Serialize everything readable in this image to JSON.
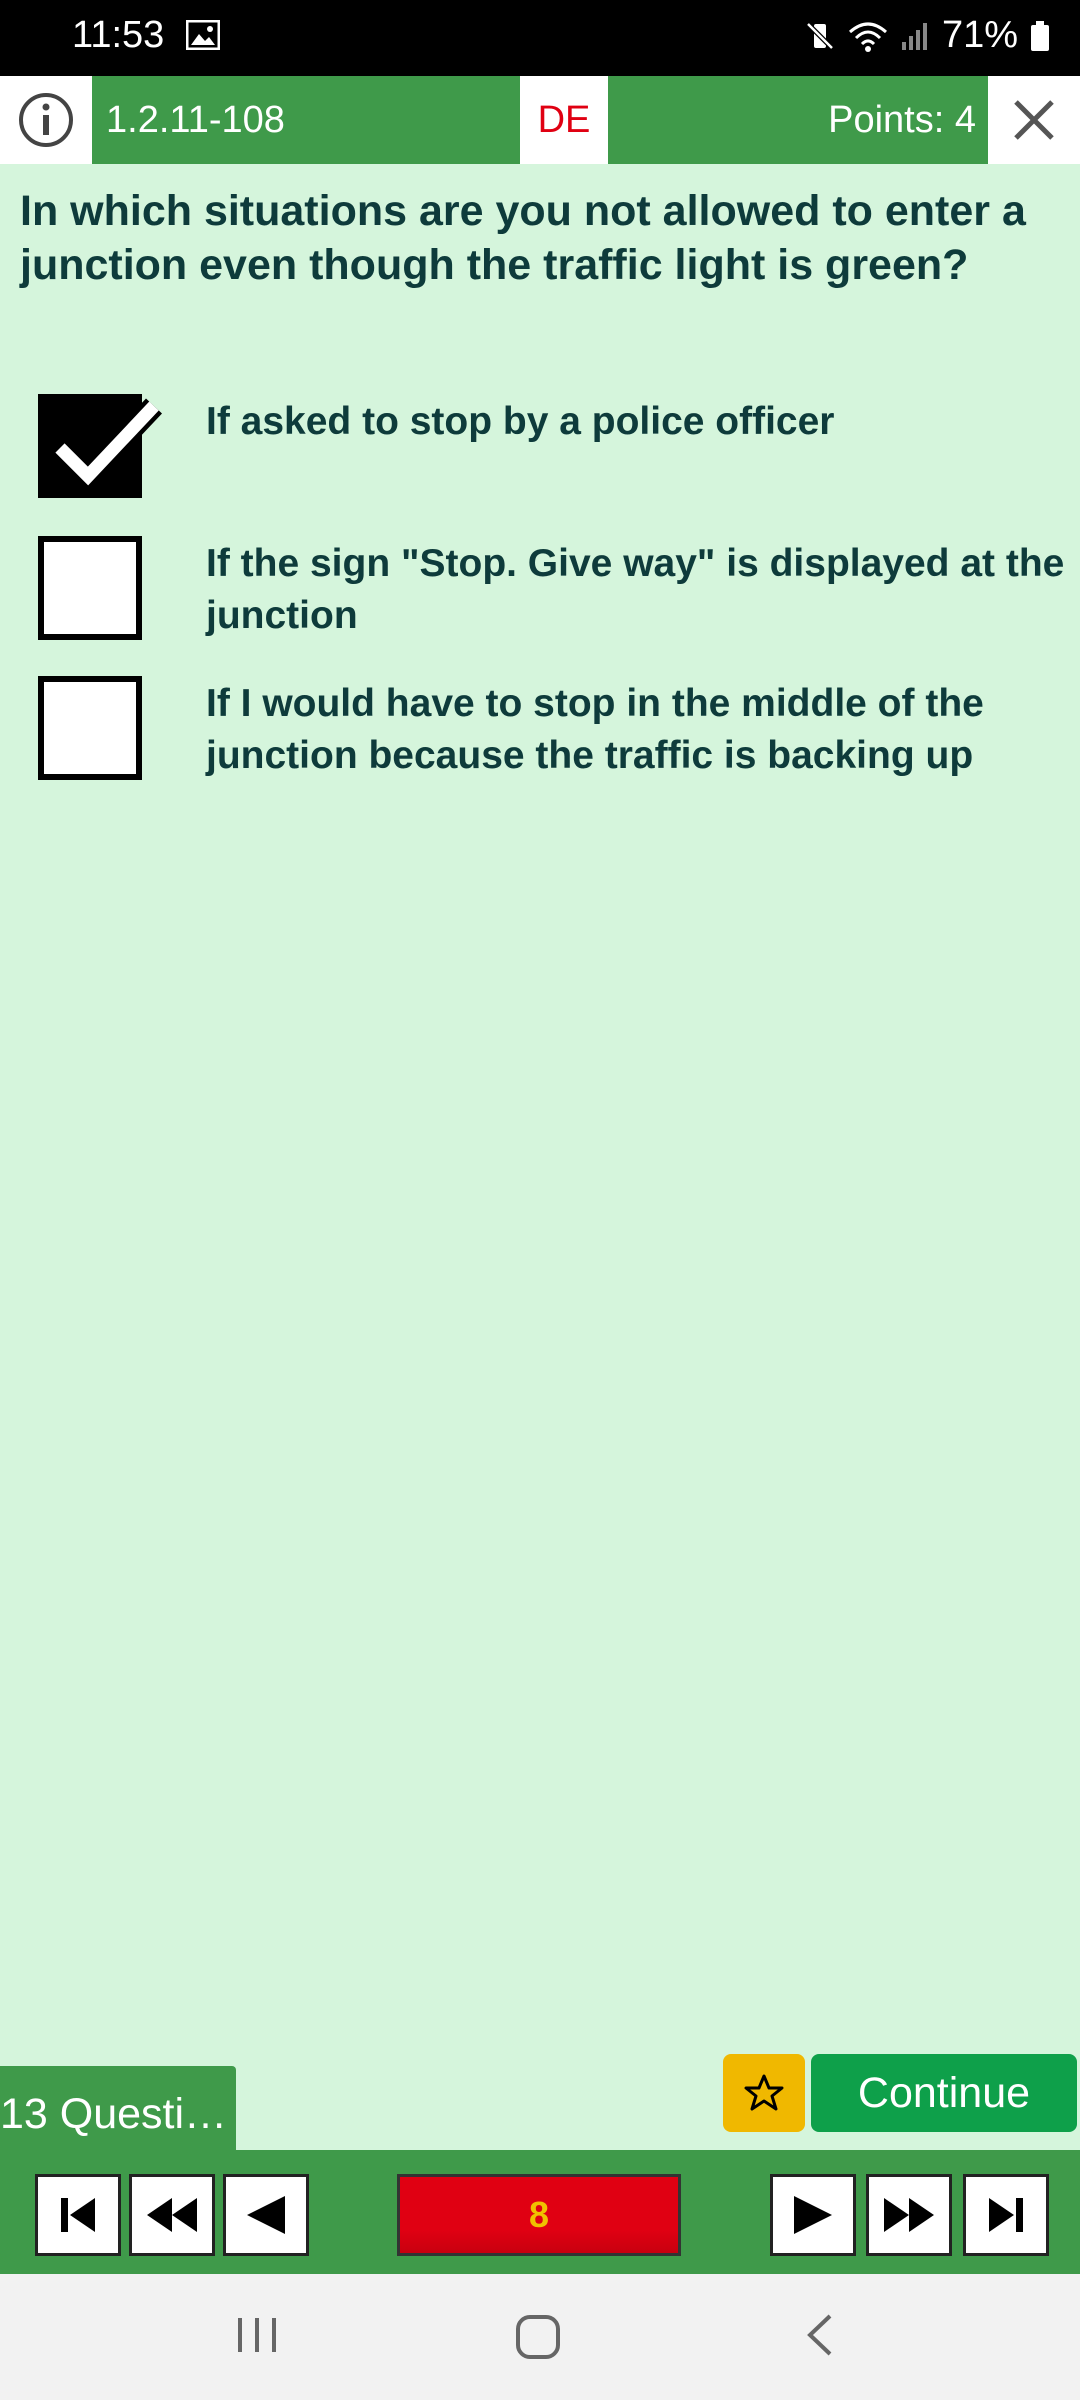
{
  "status_bar": {
    "time": "11:53",
    "battery": "71%"
  },
  "header": {
    "question_id": "1.2.11-108",
    "language": "DE",
    "points": "Points: 4"
  },
  "question": {
    "text": "In which situations are you not allowed to enter a junction even though the traffic light is green?"
  },
  "answers": [
    {
      "text": "If asked to stop by a police officer",
      "checked": true
    },
    {
      "text": "If the sign \"Stop. Give way\" is displayed at the junction",
      "checked": false
    },
    {
      "text": "If I would have to stop in the middle of the junction because the traffic is backing up",
      "checked": false
    }
  ],
  "footer": {
    "questions_tab": "13 Questi…",
    "continue_label": "Continue",
    "counter": "8"
  },
  "colors": {
    "header_green": "#3f9a4a",
    "background": "#d5f5dc",
    "continue_green": "#0ea04a",
    "star_yellow": "#f0b800",
    "counter_red": "#e00012",
    "text_dark": "#0e3b3b"
  },
  "icons": {
    "info": "info-icon",
    "close": "close-icon",
    "star": "star-icon",
    "first": "skip-first-icon",
    "back_fast": "rewind-icon",
    "back": "prev-icon",
    "forward": "next-icon",
    "forward_fast": "fast-forward-icon",
    "last": "skip-last-icon"
  }
}
